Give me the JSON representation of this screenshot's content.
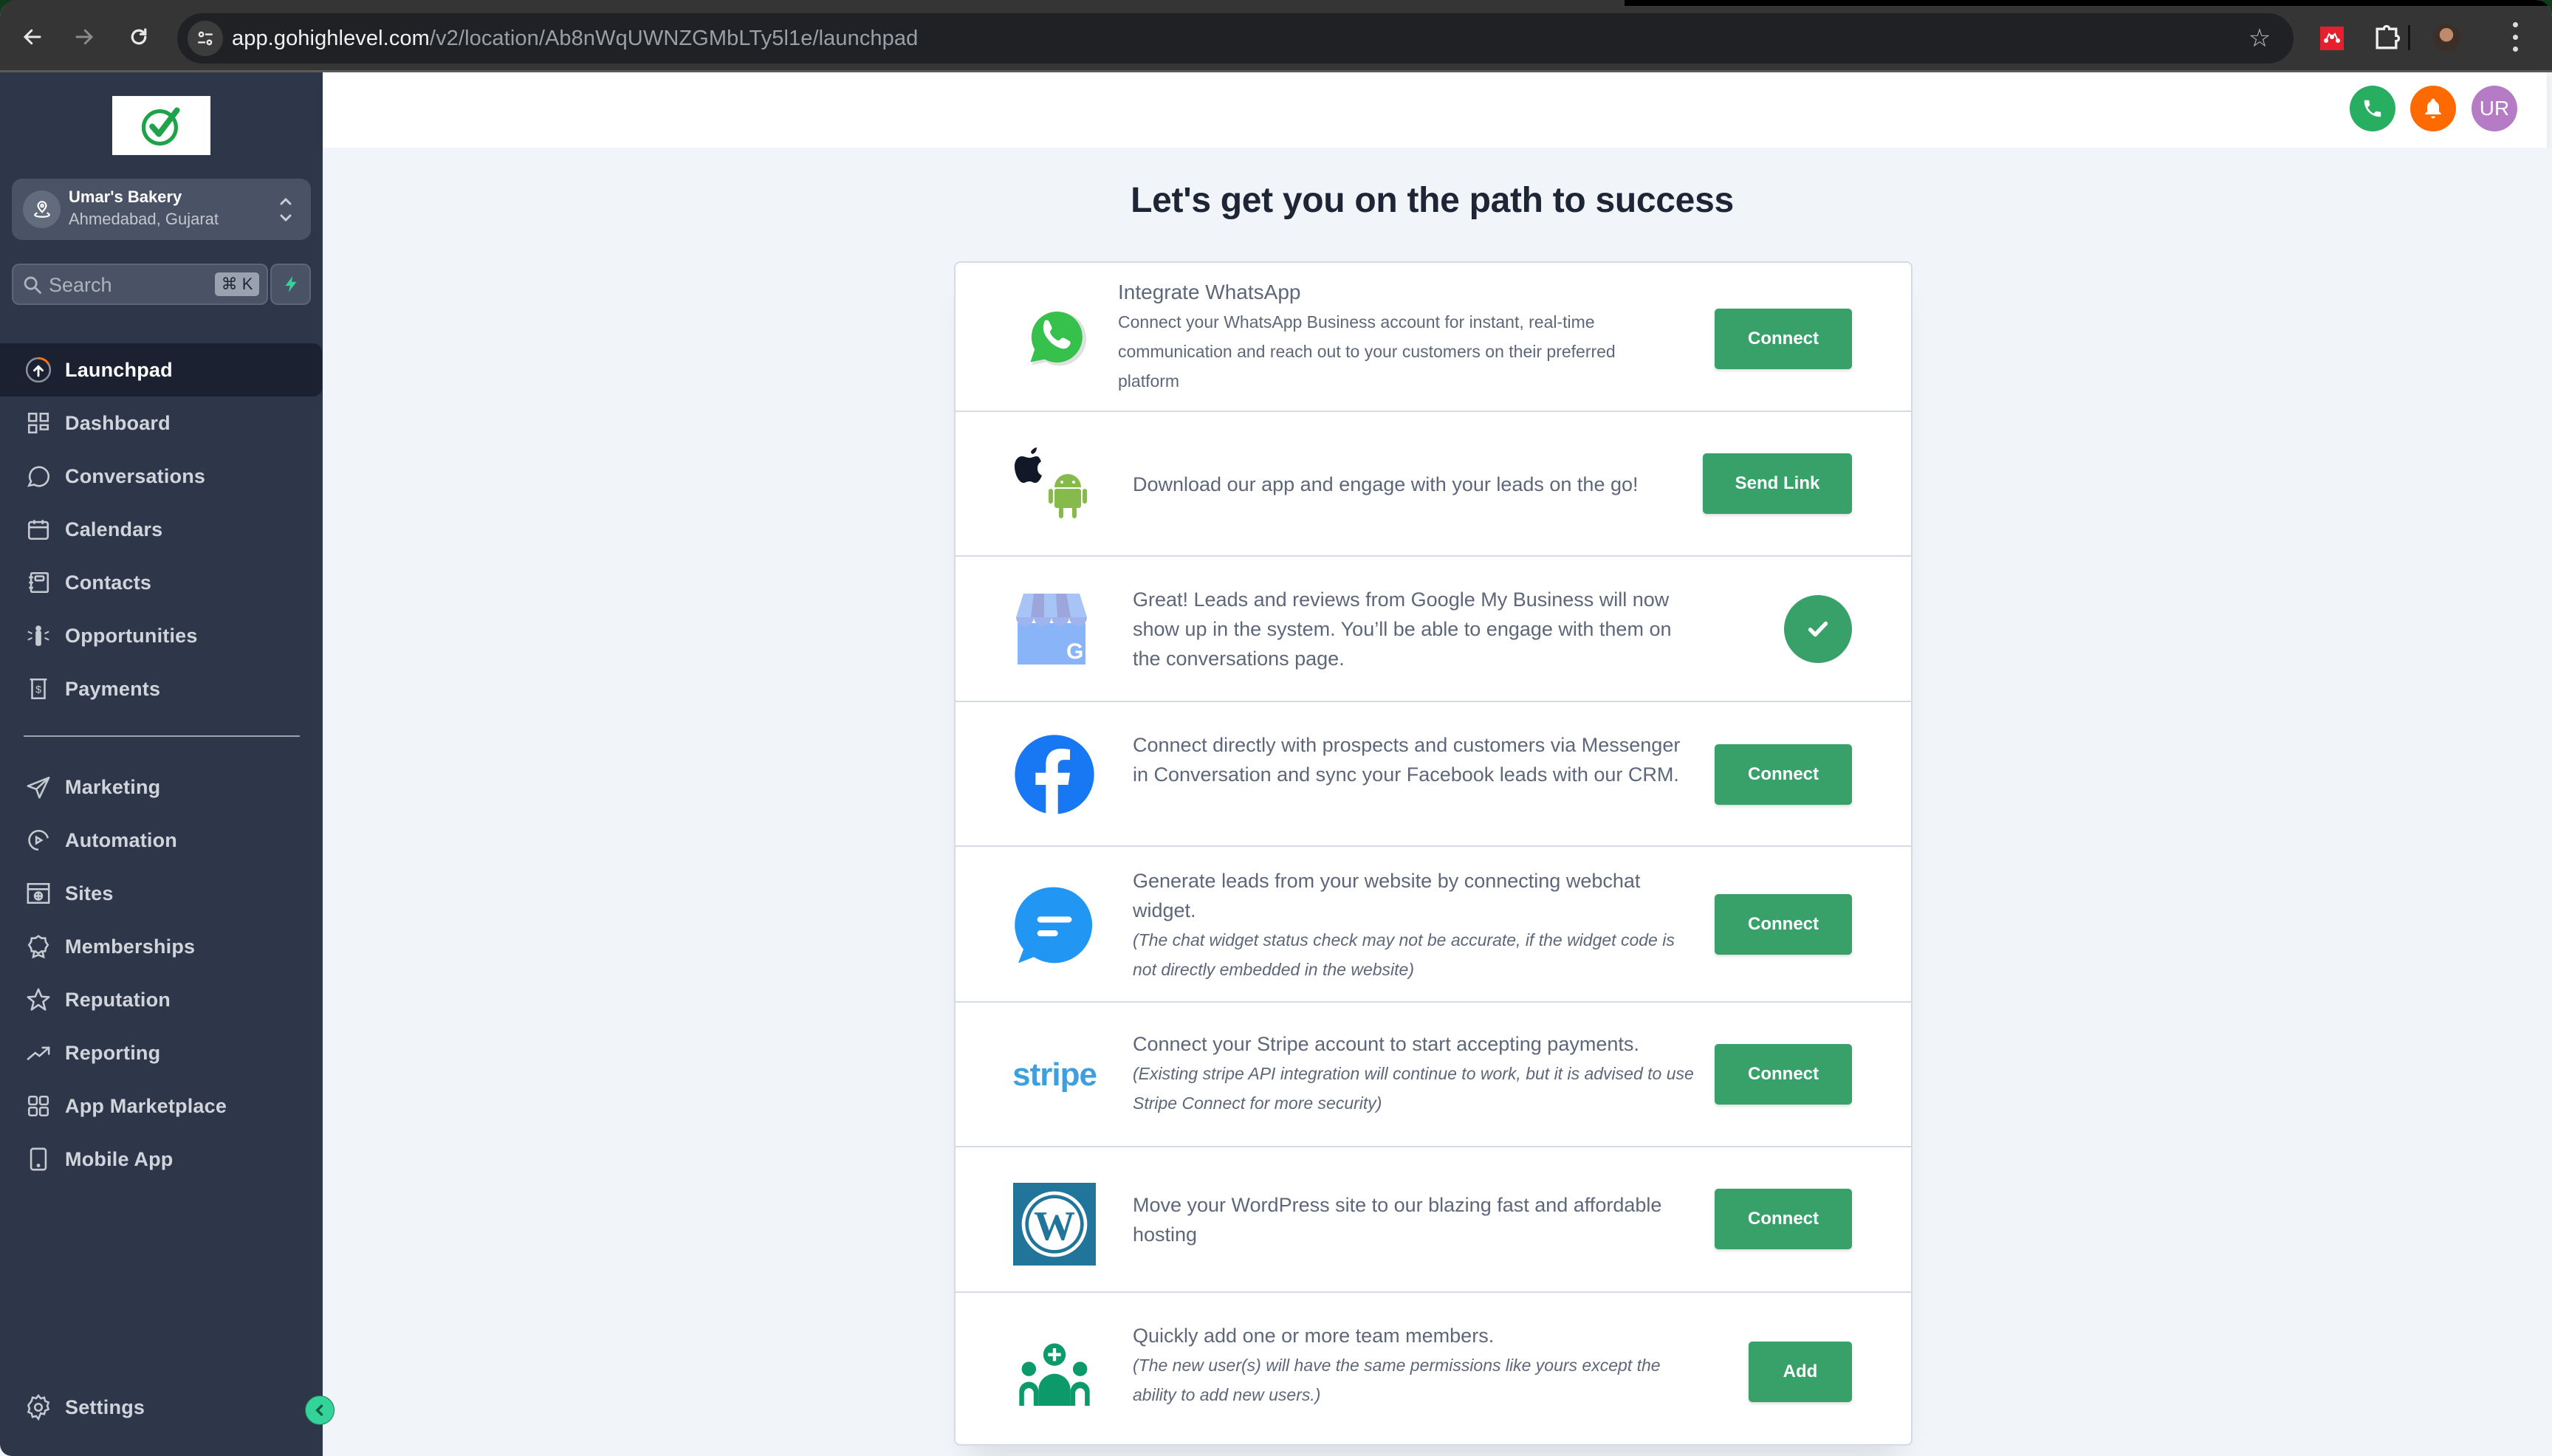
{
  "browser": {
    "url_host": "app.gohighlevel.com",
    "url_path": "/v2/location/Ab8nWqUWNZGMbLTy5l1e/launchpad"
  },
  "sidebar": {
    "location": {
      "name": "Umar's Bakery",
      "city": "Ahmedabad, Gujarat"
    },
    "search": {
      "placeholder": "Search",
      "shortcut": "⌘ K"
    },
    "items": [
      {
        "label": "Launchpad",
        "icon": "launchpad-icon",
        "active": true
      },
      {
        "label": "Dashboard",
        "icon": "dashboard-icon"
      },
      {
        "label": "Conversations",
        "icon": "chat-bubble-icon"
      },
      {
        "label": "Calendars",
        "icon": "calendar-icon"
      },
      {
        "label": "Contacts",
        "icon": "contacts-book-icon"
      },
      {
        "label": "Opportunities",
        "icon": "opportunities-icon"
      },
      {
        "label": "Payments",
        "icon": "payments-icon"
      },
      {
        "label": "Marketing",
        "icon": "send-icon"
      },
      {
        "label": "Automation",
        "icon": "automation-icon"
      },
      {
        "label": "Sites",
        "icon": "sites-globe-icon"
      },
      {
        "label": "Memberships",
        "icon": "badge-icon"
      },
      {
        "label": "Reputation",
        "icon": "star-icon"
      },
      {
        "label": "Reporting",
        "icon": "trend-up-icon"
      },
      {
        "label": "App Marketplace",
        "icon": "grid-icon"
      },
      {
        "label": "Mobile App",
        "icon": "phone-device-icon"
      }
    ],
    "settings_label": "Settings"
  },
  "header": {
    "avatar_initials": "UR",
    "colors": {
      "phone": "#27ae60",
      "bell": "#ff6a00",
      "avatar": "#b57bc4"
    }
  },
  "main": {
    "title": "Let's get you on the path to success",
    "accent_color": "#38a169",
    "cards": [
      {
        "id": "whatsapp",
        "title": "Integrate WhatsApp",
        "text": "Connect your WhatsApp Business account for instant, real-time communication and reach out to your customers on their preferred platform",
        "button": "Connect"
      },
      {
        "id": "mobile-app",
        "text": "Download our app and engage with your leads on the go!",
        "button": "Send Link"
      },
      {
        "id": "google-my-business",
        "text": "Great! Leads and reviews from Google My Business will now show up in the system. You’ll be able to engage with them on the conversations page.",
        "status": "connected"
      },
      {
        "id": "facebook",
        "text": "Connect directly with prospects and customers via Messenger in Conversation and sync your Facebook leads with our CRM.",
        "button": "Connect"
      },
      {
        "id": "webchat",
        "text": "Generate leads from your website by connecting webchat widget.",
        "note": "(The chat widget status check may not be accurate, if the widget code is not directly embedded in the website)",
        "button": "Connect"
      },
      {
        "id": "stripe",
        "logo_text": "stripe",
        "text": "Connect your Stripe account to start accepting payments.",
        "note": "(Existing stripe API integration will continue to work, but it is advised to use Stripe Connect for more security)",
        "button": "Connect"
      },
      {
        "id": "wordpress",
        "text": "Move your WordPress site to our blazing fast and affordable hosting",
        "button": "Connect"
      },
      {
        "id": "team",
        "text": "Quickly add one or more team members.",
        "note": "(The new user(s) will have the same permissions like yours except the ability to add new users.)",
        "button": "Add"
      }
    ]
  }
}
